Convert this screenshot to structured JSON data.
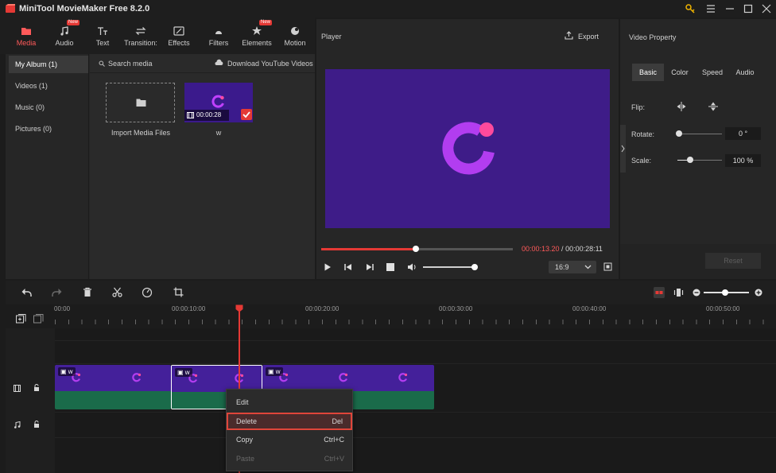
{
  "app": {
    "title": "MiniTool MovieMaker Free 8.2.0"
  },
  "toolbar": {
    "items": [
      {
        "label": "Media",
        "icon": "folder-icon"
      },
      {
        "label": "Audio",
        "icon": "music-note-icon",
        "badge": "New"
      },
      {
        "label": "Text",
        "icon": "text-icon"
      },
      {
        "label": "Transition:",
        "icon": "transition-icon"
      },
      {
        "label": "Effects",
        "icon": "effects-icon"
      },
      {
        "label": "Filters",
        "icon": "filters-icon"
      },
      {
        "label": "Elements",
        "icon": "elements-icon",
        "badge": "New"
      },
      {
        "label": "Motion",
        "icon": "motion-icon"
      }
    ]
  },
  "album": {
    "items": [
      {
        "label": "My Album (1)"
      },
      {
        "label": "Videos (1)"
      },
      {
        "label": "Music (0)"
      },
      {
        "label": "Pictures (0)"
      }
    ]
  },
  "media": {
    "search_placeholder": "Search media",
    "download_label": "Download YouTube Videos",
    "import_label": "Import Media Files",
    "clip_name": "w",
    "clip_duration": "00:00:28"
  },
  "player": {
    "title": "Player",
    "export_label": "Export",
    "current_time": "00:00:13.20",
    "separator": " / ",
    "total_time": "00:00:28:11",
    "aspect_ratio": "16:9",
    "progress_fraction": 0.5,
    "volume_fraction": 0.6
  },
  "vprop": {
    "title": "Video Property",
    "tabs": [
      "Basic",
      "Color",
      "Speed",
      "Audio"
    ],
    "flip_label": "Flip:",
    "rotate_label": "Rotate:",
    "rotate_value": "0 °",
    "scale_label": "Scale:",
    "scale_value": "100 %",
    "reset_label": "Reset"
  },
  "ruler": {
    "ticks": [
      "00:00",
      "00:00:10:00",
      "00:00:20:00",
      "00:00:30:00",
      "00:00:40:00",
      "00:00:50:00"
    ]
  },
  "timeline": {
    "clips": [
      {
        "name": "w"
      },
      {
        "name": "w"
      },
      {
        "name": "w"
      }
    ]
  },
  "context_menu": {
    "edit": "Edit",
    "delete": "Delete",
    "delete_shortcut": "Del",
    "copy": "Copy",
    "copy_shortcut": "Ctrl+C",
    "paste": "Paste",
    "paste_shortcut": "Ctrl+V"
  },
  "colors": {
    "accent": "#e53935",
    "brand_purple": "#3e1c88",
    "audio_green": "#1a6b4a"
  }
}
